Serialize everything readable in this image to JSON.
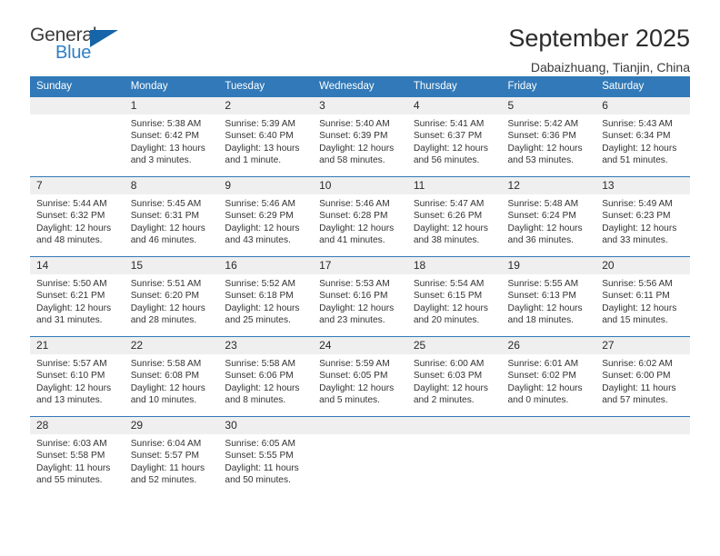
{
  "brand": {
    "name_top": "General",
    "name_bottom": "Blue",
    "triangle_color": "#1565a8",
    "blue_color": "#2f7ec4"
  },
  "header": {
    "title": "September 2025",
    "subtitle": "Dabaizhuang, Tianjin, China"
  },
  "theme": {
    "header_row_bg": "#3179b8",
    "daynum_bg": "#efefef",
    "text": "#333333"
  },
  "calendar": {
    "weekday_headers": [
      "Sunday",
      "Monday",
      "Tuesday",
      "Wednesday",
      "Thursday",
      "Friday",
      "Saturday"
    ],
    "weeks": [
      [
        {
          "day": "",
          "sunrise": "",
          "sunset": "",
          "daylight": ""
        },
        {
          "day": "1",
          "sunrise": "Sunrise: 5:38 AM",
          "sunset": "Sunset: 6:42 PM",
          "daylight": "Daylight: 13 hours and 3 minutes."
        },
        {
          "day": "2",
          "sunrise": "Sunrise: 5:39 AM",
          "sunset": "Sunset: 6:40 PM",
          "daylight": "Daylight: 13 hours and 1 minute."
        },
        {
          "day": "3",
          "sunrise": "Sunrise: 5:40 AM",
          "sunset": "Sunset: 6:39 PM",
          "daylight": "Daylight: 12 hours and 58 minutes."
        },
        {
          "day": "4",
          "sunrise": "Sunrise: 5:41 AM",
          "sunset": "Sunset: 6:37 PM",
          "daylight": "Daylight: 12 hours and 56 minutes."
        },
        {
          "day": "5",
          "sunrise": "Sunrise: 5:42 AM",
          "sunset": "Sunset: 6:36 PM",
          "daylight": "Daylight: 12 hours and 53 minutes."
        },
        {
          "day": "6",
          "sunrise": "Sunrise: 5:43 AM",
          "sunset": "Sunset: 6:34 PM",
          "daylight": "Daylight: 12 hours and 51 minutes."
        }
      ],
      [
        {
          "day": "7",
          "sunrise": "Sunrise: 5:44 AM",
          "sunset": "Sunset: 6:32 PM",
          "daylight": "Daylight: 12 hours and 48 minutes."
        },
        {
          "day": "8",
          "sunrise": "Sunrise: 5:45 AM",
          "sunset": "Sunset: 6:31 PM",
          "daylight": "Daylight: 12 hours and 46 minutes."
        },
        {
          "day": "9",
          "sunrise": "Sunrise: 5:46 AM",
          "sunset": "Sunset: 6:29 PM",
          "daylight": "Daylight: 12 hours and 43 minutes."
        },
        {
          "day": "10",
          "sunrise": "Sunrise: 5:46 AM",
          "sunset": "Sunset: 6:28 PM",
          "daylight": "Daylight: 12 hours and 41 minutes."
        },
        {
          "day": "11",
          "sunrise": "Sunrise: 5:47 AM",
          "sunset": "Sunset: 6:26 PM",
          "daylight": "Daylight: 12 hours and 38 minutes."
        },
        {
          "day": "12",
          "sunrise": "Sunrise: 5:48 AM",
          "sunset": "Sunset: 6:24 PM",
          "daylight": "Daylight: 12 hours and 36 minutes."
        },
        {
          "day": "13",
          "sunrise": "Sunrise: 5:49 AM",
          "sunset": "Sunset: 6:23 PM",
          "daylight": "Daylight: 12 hours and 33 minutes."
        }
      ],
      [
        {
          "day": "14",
          "sunrise": "Sunrise: 5:50 AM",
          "sunset": "Sunset: 6:21 PM",
          "daylight": "Daylight: 12 hours and 31 minutes."
        },
        {
          "day": "15",
          "sunrise": "Sunrise: 5:51 AM",
          "sunset": "Sunset: 6:20 PM",
          "daylight": "Daylight: 12 hours and 28 minutes."
        },
        {
          "day": "16",
          "sunrise": "Sunrise: 5:52 AM",
          "sunset": "Sunset: 6:18 PM",
          "daylight": "Daylight: 12 hours and 25 minutes."
        },
        {
          "day": "17",
          "sunrise": "Sunrise: 5:53 AM",
          "sunset": "Sunset: 6:16 PM",
          "daylight": "Daylight: 12 hours and 23 minutes."
        },
        {
          "day": "18",
          "sunrise": "Sunrise: 5:54 AM",
          "sunset": "Sunset: 6:15 PM",
          "daylight": "Daylight: 12 hours and 20 minutes."
        },
        {
          "day": "19",
          "sunrise": "Sunrise: 5:55 AM",
          "sunset": "Sunset: 6:13 PM",
          "daylight": "Daylight: 12 hours and 18 minutes."
        },
        {
          "day": "20",
          "sunrise": "Sunrise: 5:56 AM",
          "sunset": "Sunset: 6:11 PM",
          "daylight": "Daylight: 12 hours and 15 minutes."
        }
      ],
      [
        {
          "day": "21",
          "sunrise": "Sunrise: 5:57 AM",
          "sunset": "Sunset: 6:10 PM",
          "daylight": "Daylight: 12 hours and 13 minutes."
        },
        {
          "day": "22",
          "sunrise": "Sunrise: 5:58 AM",
          "sunset": "Sunset: 6:08 PM",
          "daylight": "Daylight: 12 hours and 10 minutes."
        },
        {
          "day": "23",
          "sunrise": "Sunrise: 5:58 AM",
          "sunset": "Sunset: 6:06 PM",
          "daylight": "Daylight: 12 hours and 8 minutes."
        },
        {
          "day": "24",
          "sunrise": "Sunrise: 5:59 AM",
          "sunset": "Sunset: 6:05 PM",
          "daylight": "Daylight: 12 hours and 5 minutes."
        },
        {
          "day": "25",
          "sunrise": "Sunrise: 6:00 AM",
          "sunset": "Sunset: 6:03 PM",
          "daylight": "Daylight: 12 hours and 2 minutes."
        },
        {
          "day": "26",
          "sunrise": "Sunrise: 6:01 AM",
          "sunset": "Sunset: 6:02 PM",
          "daylight": "Daylight: 12 hours and 0 minutes."
        },
        {
          "day": "27",
          "sunrise": "Sunrise: 6:02 AM",
          "sunset": "Sunset: 6:00 PM",
          "daylight": "Daylight: 11 hours and 57 minutes."
        }
      ],
      [
        {
          "day": "28",
          "sunrise": "Sunrise: 6:03 AM",
          "sunset": "Sunset: 5:58 PM",
          "daylight": "Daylight: 11 hours and 55 minutes."
        },
        {
          "day": "29",
          "sunrise": "Sunrise: 6:04 AM",
          "sunset": "Sunset: 5:57 PM",
          "daylight": "Daylight: 11 hours and 52 minutes."
        },
        {
          "day": "30",
          "sunrise": "Sunrise: 6:05 AM",
          "sunset": "Sunset: 5:55 PM",
          "daylight": "Daylight: 11 hours and 50 minutes."
        },
        {
          "day": "",
          "sunrise": "",
          "sunset": "",
          "daylight": ""
        },
        {
          "day": "",
          "sunrise": "",
          "sunset": "",
          "daylight": ""
        },
        {
          "day": "",
          "sunrise": "",
          "sunset": "",
          "daylight": ""
        },
        {
          "day": "",
          "sunrise": "",
          "sunset": "",
          "daylight": ""
        }
      ]
    ]
  }
}
